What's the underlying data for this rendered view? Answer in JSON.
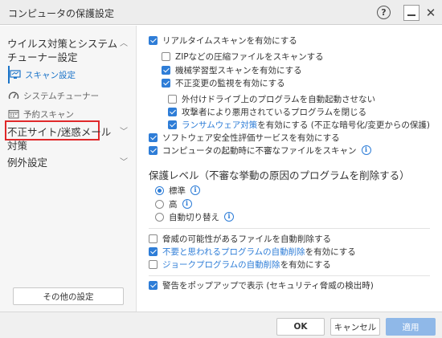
{
  "window": {
    "title": "コンピュータの保護設定",
    "help_label": "?",
    "close_label": "✕"
  },
  "sidebar": {
    "group1": {
      "label_line1": "ウイルス対策とシステム",
      "label_line2": "チューナー設定"
    },
    "items": [
      {
        "label": "スキャン設定",
        "active": true,
        "icon": "scan-monitor-icon"
      },
      {
        "label": "システムチューナー",
        "active": false,
        "icon": "gauge-icon"
      },
      {
        "label": "予約スキャン",
        "active": false,
        "icon": "calendar-icon",
        "highlighted": true
      }
    ],
    "group2": {
      "label_line1": "不正サイト/迷惑メール",
      "label_line2": "対策"
    },
    "group3": {
      "label": "例外設定"
    },
    "other_settings_label": "その他の設定"
  },
  "main": {
    "options": [
      {
        "label": "リアルタイムスキャンを有効にする",
        "checked": true
      },
      {
        "label": "ZIPなどの圧縮ファイルをスキャンする",
        "checked": false
      },
      {
        "label": "機械学習型スキャンを有効にする",
        "checked": true
      },
      {
        "label": "不正変更の監視を有効にする",
        "checked": true
      },
      {
        "label": "外付けドライブ上のプログラムを自動起動させない",
        "checked": false
      },
      {
        "label": "攻撃者により悪用されているプログラムを閉じる",
        "checked": true
      },
      {
        "label_link": "ランサムウェア対策",
        "label_rest": "を有効にする (不正な暗号化/変更からの保護)",
        "checked": true
      },
      {
        "label": "ソフトウェア安全性評価サービスを有効にする",
        "checked": true
      },
      {
        "label": "コンピュータの起動時に不審なファイルをスキャン",
        "checked": true
      }
    ],
    "protection_title": "保護レベル（不審な挙動の原因のプログラムを削除する）",
    "levels": [
      {
        "label": "標準",
        "selected": true
      },
      {
        "label": "高",
        "selected": false
      },
      {
        "label": "自動切り替え",
        "selected": false
      }
    ],
    "auto_delete": [
      {
        "label": "脅威の可能性があるファイルを自動削除する",
        "checked": false
      },
      {
        "label_link": "不要と思われるプログラムの自動削除",
        "label_rest": "を有効にする",
        "checked": true
      },
      {
        "label_link": "ジョークプログラムの自動削除",
        "label_rest": "を有効にする",
        "checked": false
      }
    ],
    "popup": {
      "label": "警告をポップアップで表示 (セキュリティ脅威の検出時)",
      "checked": true
    },
    "info_glyph": "i"
  },
  "footer": {
    "ok_label": "OK",
    "cancel_label": "キャンセル",
    "apply_label": "適用"
  },
  "colors": {
    "accent": "#2e7dd7",
    "highlight": "#e0282a"
  }
}
